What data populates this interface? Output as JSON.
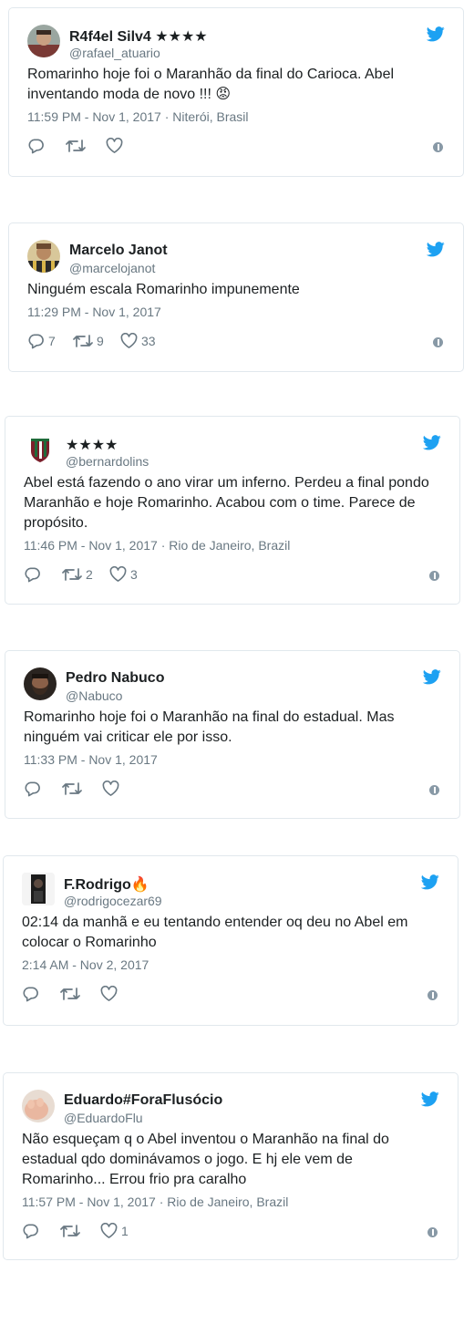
{
  "colors": {
    "twitter_blue": "#1da1f2",
    "meta_gray": "#697882",
    "border": "#e1e8ed"
  },
  "tweets": [
    {
      "name": "R4f4el Silv4 ★★★★",
      "handle": "@rafael_atuario",
      "text": "Romarinho hoje foi o Maranhão da final do Carioca. Abel inventando moda de novo !!! 😡",
      "time": "11:59 PM - Nov 1, 2017",
      "location": "· Niterói, Brasil",
      "replies": "",
      "retweets": "",
      "likes": "",
      "avatar_icon": "man-red-shirt-avatar"
    },
    {
      "name": "Marcelo Janot",
      "handle": "@marcelojanot",
      "text": "Ninguém escala Romarinho impunemente",
      "time": "11:29 PM - Nov 1, 2017",
      "location": "",
      "replies": "7",
      "retweets": "9",
      "likes": "33",
      "avatar_icon": "man-striped-shirt-avatar"
    },
    {
      "name": "★★★★",
      "handle": "@bernardolins",
      "text": "Abel está fazendo o ano virar um inferno. Perdeu a final pondo Maranhão e hoje Romarinho. Acabou com o time. Parece de propósito.",
      "time": "11:46 PM - Nov 1, 2017",
      "location": "· Rio de Janeiro, Brazil",
      "replies": "",
      "retweets": "2",
      "likes": "3",
      "avatar_icon": "fluminense-crest-avatar"
    },
    {
      "name": "Pedro Nabuco",
      "handle": "@Nabuco",
      "text": "Romarinho hoje foi o Maranhão na final do estadual. Mas ninguém vai criticar ele por isso.",
      "time": "11:33 PM - Nov 1, 2017",
      "location": "",
      "replies": "",
      "retweets": "",
      "likes": "",
      "avatar_icon": "bearded-man-avatar"
    },
    {
      "name": "F.Rodrigo🔥",
      "handle": "@rodrigocezar69",
      "text": "02:14 da manhã e eu tentando entender oq deu no Abel em colocar o Romarinho",
      "time": "2:14 AM - Nov 2, 2017",
      "location": "",
      "replies": "",
      "retweets": "",
      "likes": "",
      "avatar_icon": "dark-figure-avatar"
    },
    {
      "name": "Eduardo#ForaFlusócio",
      "handle": "@EduardoFlu",
      "text": "Não esqueçam q o Abel inventou o Maranhão na final do estadual qdo dominávamos o jogo. E hj ele vem de Romarinho... Errou frio pra caralho",
      "time": "11:57 PM - Nov 1, 2017",
      "location": "· Rio de Janeiro, Brazil",
      "replies": "",
      "retweets": "",
      "likes": "1",
      "avatar_icon": "baby-hand-avatar"
    }
  ]
}
